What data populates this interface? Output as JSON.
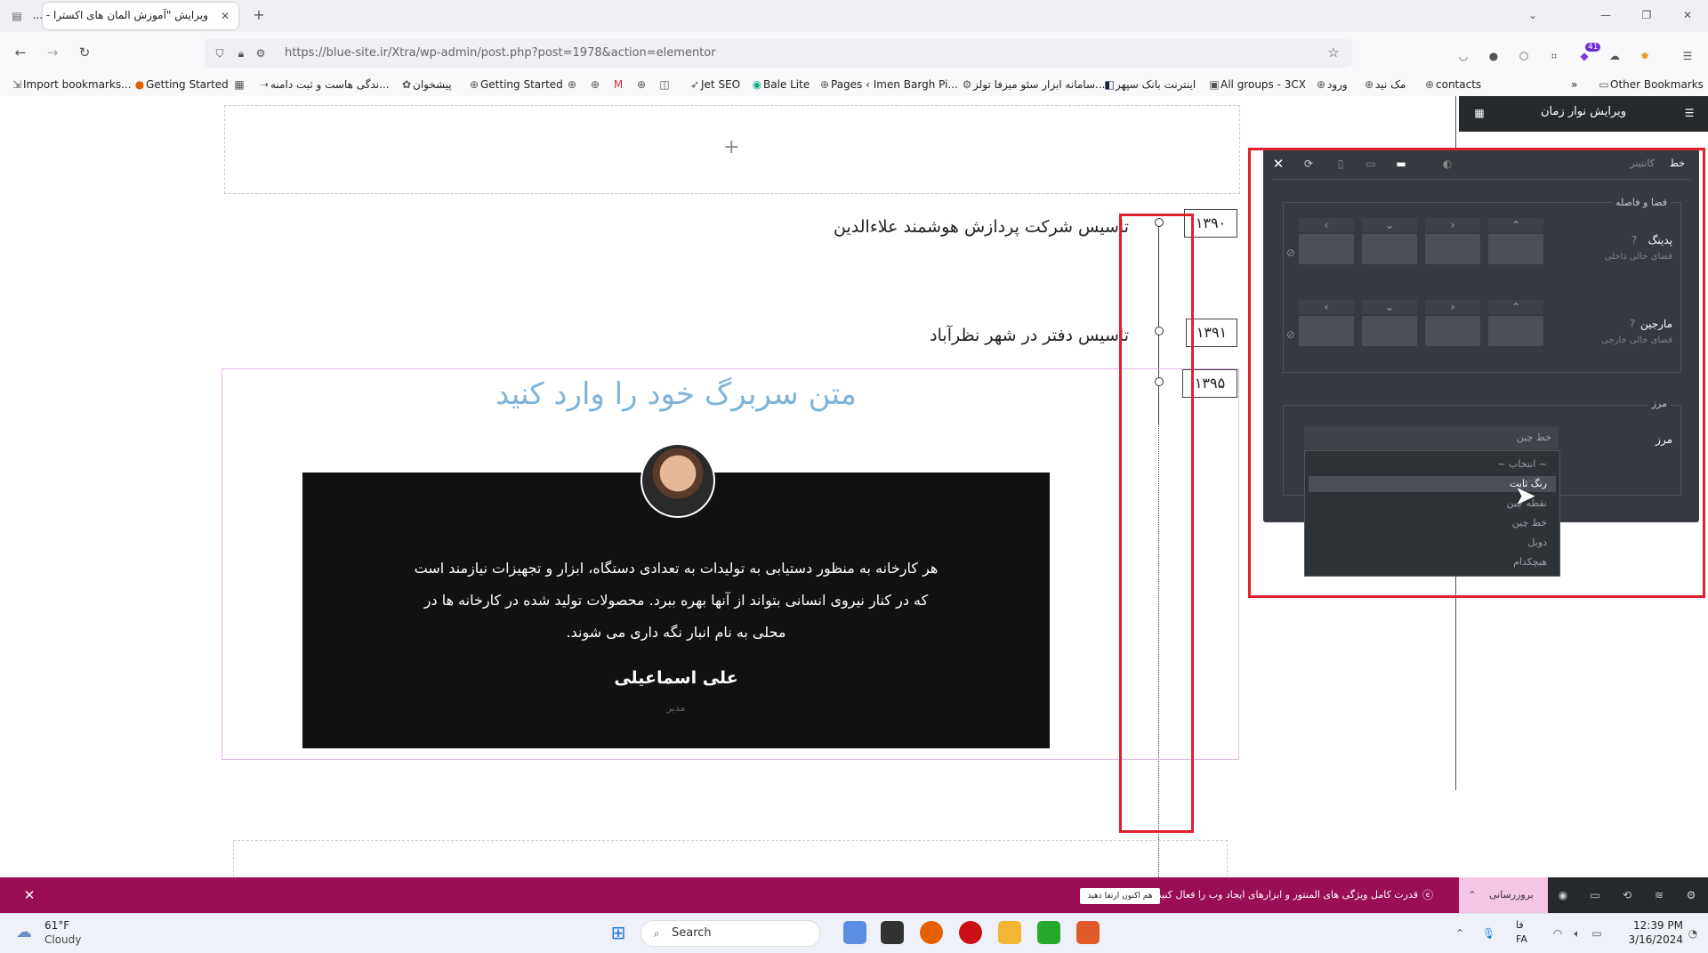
{
  "browser": {
    "tab_title": "ویرایش \"آموزش المان های اکسترا - ...",
    "url": "https://blue-site.ir/Xtra/wp-admin/post.php?post=1978&action=elementor",
    "bookmarks": [
      "Import bookmarks...",
      "Getting Started",
      "...ندگی هاست و ثبت دامنه",
      "پیشخوان",
      "Getting Started",
      "Jet SEO",
      "Bale Lite",
      "Pages ‹ Imen Bargh Pi...",
      "...سامانه ابزار سئو میزفا تولز",
      "اینترنت بانک سپهر",
      "All groups - 3CX",
      "ورود",
      "مک نید",
      "contacts"
    ],
    "other_bookmarks": "Other Bookmarks",
    "extension_badge": "41"
  },
  "canvas": {
    "add_section": "+",
    "timeline": [
      {
        "year": "۱۳۹۰",
        "text": "تاسیس شرکت پردازش هوشمند علاءالدین"
      },
      {
        "year": "۱۳۹۱",
        "text": "تاسیس دفتر در شهر نظرآباد"
      },
      {
        "year": "۱۳۹۵",
        "text": ""
      }
    ],
    "heading": "متن سربرگ خود را وارد کنید",
    "testimonial": {
      "lines": [
        "هر کارخانه به منظور دستیابی به تولیدات به تعدادی دستگاه، ابزار و تجهیزات نیازمند است",
        "که در کنار نیروی انسانی بتواند از آنها بهره ببرد. محصولات تولید شده در کارخانه ها در",
        "محلی به نام انبار نگه داری می شوند."
      ],
      "name": "علی اسماعیلی",
      "role": "مدیر"
    }
  },
  "panel": {
    "title": "ویرایش نوار زمان",
    "popover": {
      "tab_line": "خط",
      "tab_container": "کانتینر",
      "section_spacing": "فضا و فاصله",
      "padding_label": "پدینگ",
      "padding_sub": "فضای خالی داخلی",
      "margin_label": "مارجین",
      "margin_sub": "فضای خالی خارجی",
      "section_border": "مرز",
      "border_label": "مرز",
      "border_value": "خط چین",
      "options": [
        "~ انتخاب ~",
        "رنگ ثابت",
        "نقطه چین",
        "خط چین",
        "دوبل",
        "هیچکدام"
      ]
    }
  },
  "notice": {
    "text": "قدرت کامل ویژگی های المنتور و ابزارهای ایجاد وب را فعال کنید.",
    "button": "هم اکنون ارتقا دهید",
    "update_label": "بروزرسانی"
  },
  "taskbar": {
    "temp": "61°F",
    "weather": "Cloudy",
    "search": "Search",
    "lang_top": "فا",
    "lang_bottom": "FA",
    "time": "12:39 PM",
    "date": "3/16/2024"
  },
  "colors": {
    "accent_red": "#e0202c",
    "heading_blue": "#7fb4d9",
    "notice_bg": "#9a0e53",
    "panel_bg": "#343a40"
  }
}
